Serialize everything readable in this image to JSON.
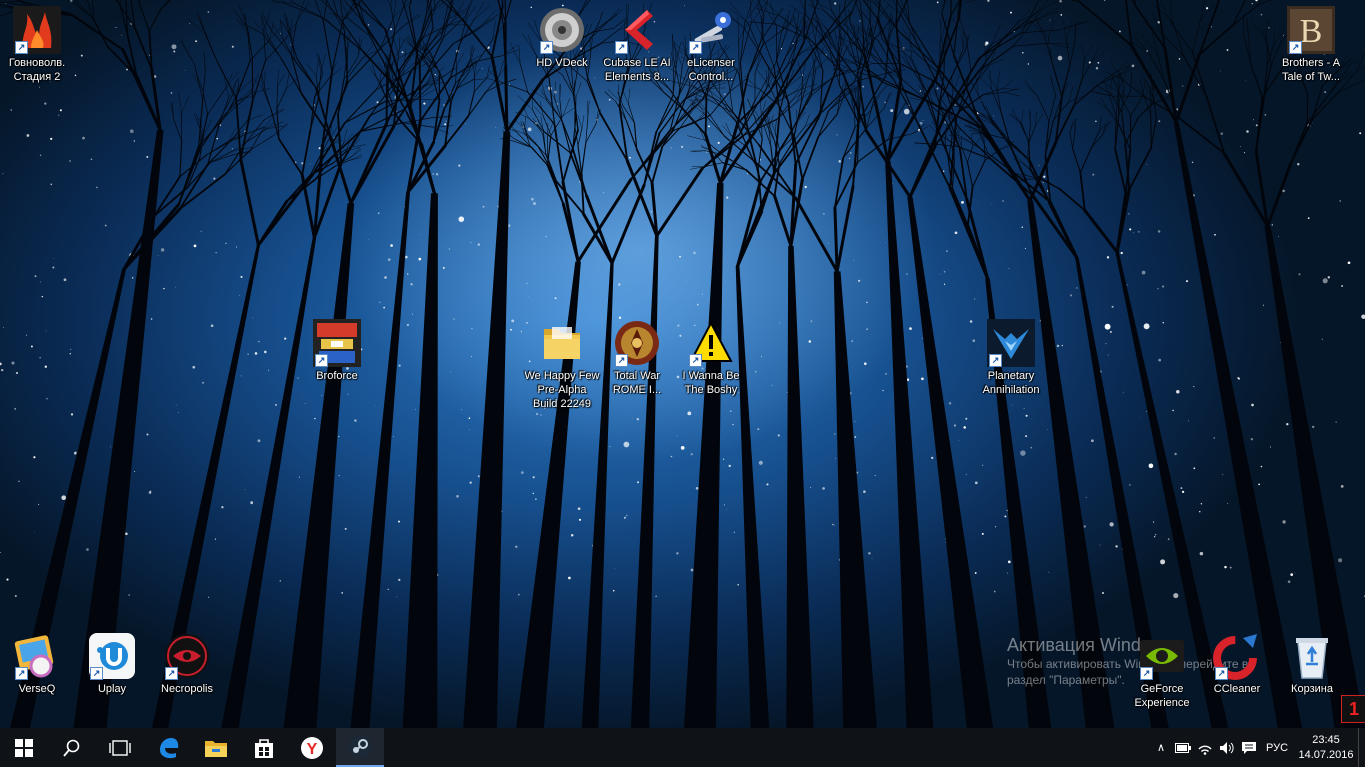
{
  "desktop": {
    "icons": [
      {
        "id": "govnovolv",
        "label": "Говноволв. Стадия 2",
        "icon": "flame-icon"
      },
      {
        "id": "hdvdeck",
        "label": "HD VDeck",
        "icon": "speaker-icon"
      },
      {
        "id": "cubase",
        "label": "Cubase LE AI Elements 8...",
        "icon": "cubase-icon"
      },
      {
        "id": "elicenser",
        "label": "eLicenser Control...",
        "icon": "keys-icon"
      },
      {
        "id": "brothers",
        "label": "Brothers - A Tale of Tw...",
        "icon": "brothers-icon"
      },
      {
        "id": "broforce",
        "label": "Broforce",
        "icon": "broforce-icon"
      },
      {
        "id": "wehappyfew",
        "label": "We Happy Few Pre-Alpha Build 22249",
        "icon": "folder-icon"
      },
      {
        "id": "totalwar",
        "label": "Total War ROME I...",
        "icon": "rome-icon"
      },
      {
        "id": "iwannabe",
        "label": "I Wanna Be The Boshy",
        "icon": "warning-icon"
      },
      {
        "id": "planetary",
        "label": "Planetary Annihilation",
        "icon": "planetary-icon"
      },
      {
        "id": "verseq",
        "label": "VerseQ",
        "icon": "verseq-icon"
      },
      {
        "id": "uplay",
        "label": "Uplay",
        "icon": "uplay-icon"
      },
      {
        "id": "necropolis",
        "label": "Necropolis",
        "icon": "necropolis-icon"
      },
      {
        "id": "geforce",
        "label": "GeForce Experience",
        "icon": "nvidia-icon"
      },
      {
        "id": "ccleaner",
        "label": "CCleaner",
        "icon": "ccleaner-icon"
      },
      {
        "id": "recycle",
        "label": "Корзина",
        "icon": "recycle-bin-icon"
      }
    ],
    "shortcut_glyph": "↗"
  },
  "activation": {
    "title": "Активация Windows",
    "line1": "Чтобы активировать Windows, перейдите в",
    "line2": "раздел \"Параметры\"."
  },
  "notification_badge": "1",
  "taskbar": {
    "pinned": [
      "start-button",
      "search-button",
      "task-view-button",
      "edge-icon",
      "file-explorer-icon",
      "store-icon",
      "yandex-browser-icon",
      "steam-icon"
    ],
    "tray": {
      "chevron": "∧",
      "language": "РУС",
      "time": "23:45",
      "date": "14.07.2016"
    }
  },
  "colors": {
    "taskbar": "#0f1318",
    "accent": "#1e90ff"
  }
}
